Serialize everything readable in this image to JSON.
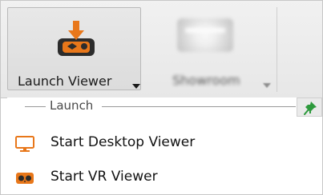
{
  "ribbon": {
    "launch_viewer": {
      "label": "Launch Viewer",
      "icon": "launch-viewer-icon"
    },
    "showroom": {
      "label": "Showroom",
      "icon": "showroom-icon",
      "blurred": true
    }
  },
  "menu": {
    "group_label": "Launch",
    "pin_icon": "pin-icon",
    "items": [
      {
        "label": "Start Desktop Viewer",
        "icon": "desktop-monitor-icon"
      },
      {
        "label": "Start VR Viewer",
        "icon": "vr-headset-icon"
      }
    ]
  },
  "colors": {
    "accent_orange": "#e8771a",
    "icon_dark": "#2a2a2a",
    "pin_green": "#2e9a3d"
  }
}
